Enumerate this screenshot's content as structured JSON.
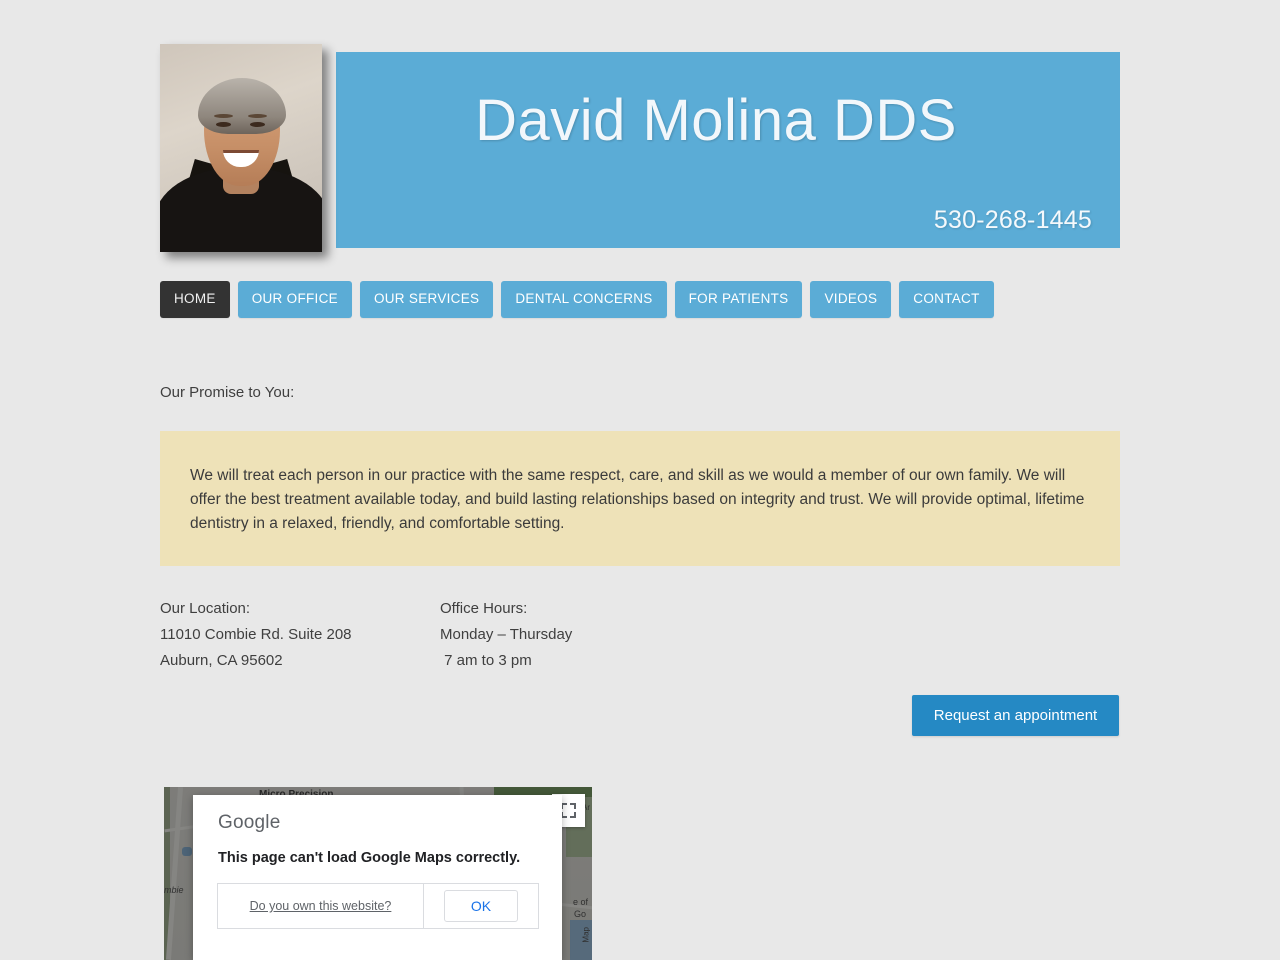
{
  "site": {
    "title": "David Molina DDS",
    "phone": "530-268-1445",
    "portrait_alt": "Dr. David Molina portrait"
  },
  "nav": {
    "items": [
      {
        "label": "HOME",
        "active": true
      },
      {
        "label": "OUR OFFICE",
        "active": false
      },
      {
        "label": "OUR SERVICES",
        "active": false
      },
      {
        "label": "DENTAL CONCERNS",
        "active": false
      },
      {
        "label": "FOR PATIENTS",
        "active": false
      },
      {
        "label": "VIDEOS",
        "active": false
      },
      {
        "label": "CONTACT",
        "active": false
      }
    ]
  },
  "promise": {
    "label": "Our Promise to You:",
    "text": "We will treat each person in our practice with the same respect, care, and skill as we would a member of our own family. We will offer the best treatment available today, and build lasting relationships based on integrity and trust. We will provide optimal, lifetime dentistry in a relaxed, friendly, and comfortable setting."
  },
  "location": {
    "heading": "Our Location:",
    "line1": "11010 Combie Rd. Suite 208",
    "line2": "Auburn, CA 95602"
  },
  "hours": {
    "heading": "Office Hours:",
    "line1": "Monday – Thursday",
    "line2": " 7 am to 3 pm"
  },
  "cta": {
    "appointment_label": "Request an appointment"
  },
  "map": {
    "labels": {
      "micro_precision": "Micro Precision",
      "combie": "mbie",
      "terms_line1": "e of",
      "terms_line2": "Go",
      "side": "Map",
      "ar": "Ar"
    }
  },
  "gm_dialog": {
    "brand": "Google",
    "message": "This page can't load Google Maps correctly.",
    "own_site_link": "Do you own this website?",
    "ok_label": "OK"
  },
  "colors": {
    "page_background": "#e8e8e8",
    "header_blue": "#5bacd6",
    "nav_active": "#333333",
    "promise_beige": "#eee2b8",
    "cta_blue": "#2589c4",
    "link_blue": "#1a73e8"
  }
}
